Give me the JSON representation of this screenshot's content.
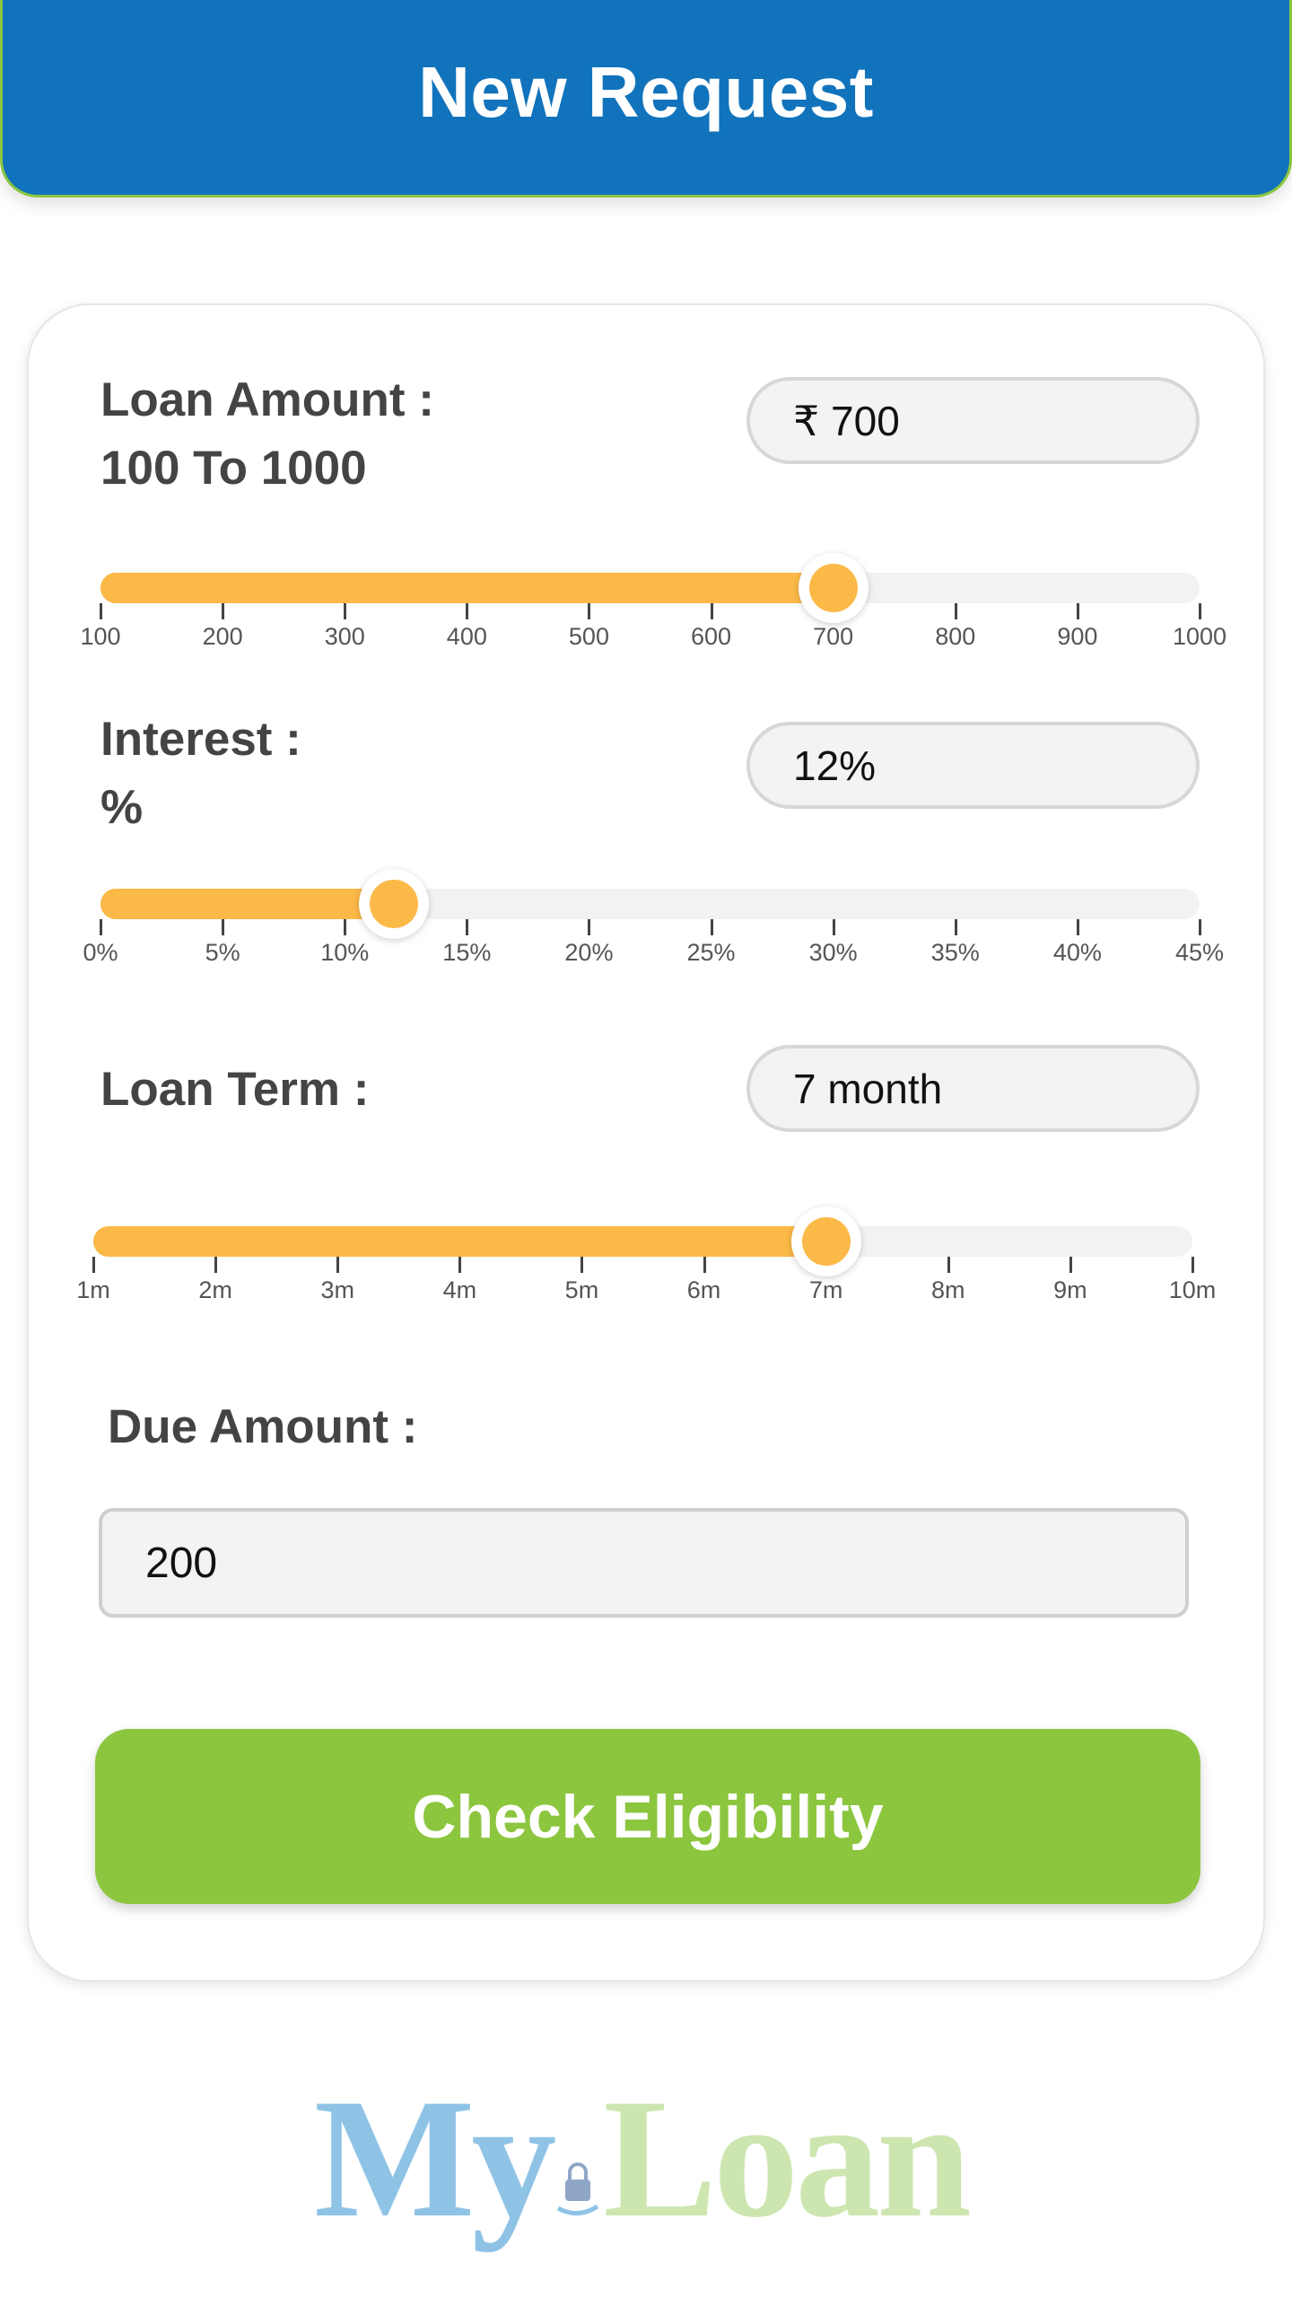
{
  "header": {
    "title": "New Request"
  },
  "loan_amount": {
    "label": "Loan Amount :",
    "range_text": "100 To 1000",
    "value_text": "₹ 700",
    "value": 700,
    "min": 100,
    "max": 1000,
    "ticks": [
      "100",
      "200",
      "300",
      "400",
      "500",
      "600",
      "700",
      "800",
      "900",
      "1000"
    ]
  },
  "interest": {
    "label": "Interest :",
    "unit_text": "%",
    "value_text": "12%",
    "value": 12,
    "min": 0,
    "max": 45,
    "ticks": [
      "0%",
      "5%",
      "10%",
      "15%",
      "20%",
      "25%",
      "30%",
      "35%",
      "40%",
      "45%"
    ]
  },
  "loan_term": {
    "label": "Loan Term :",
    "value_text": "7 month",
    "value": 7,
    "min": 1,
    "max": 10,
    "ticks": [
      "1m",
      "2m",
      "3m",
      "4m",
      "5m",
      "6m",
      "7m",
      "8m",
      "9m",
      "10m"
    ]
  },
  "due": {
    "label": "Due Amount :",
    "value": "200"
  },
  "cta": {
    "label": "Check Eligibility"
  },
  "logo": {
    "part1": "My",
    "part2": "Loan"
  },
  "colors": {
    "header": "#1173BC",
    "accent_green": "#8CC63F",
    "slider": "#FBB948"
  }
}
